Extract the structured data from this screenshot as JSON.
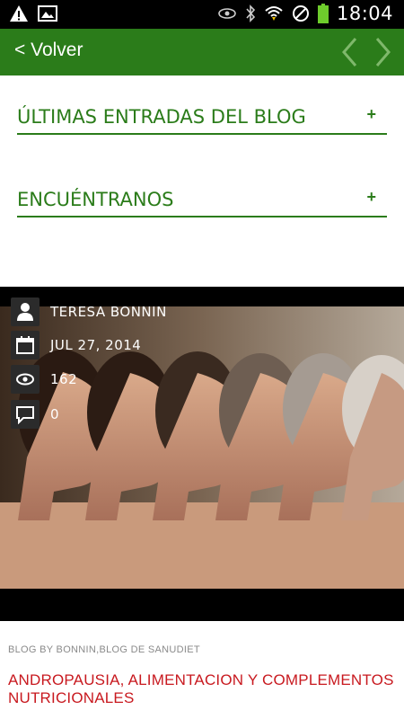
{
  "status_bar": {
    "time": "18:04"
  },
  "header": {
    "back_label": "< Volver"
  },
  "sections": [
    {
      "label": "ÚLTIMAS ENTRADAS DEL BLOG",
      "expand": "+"
    },
    {
      "label": "ENCUÉNTRANOS",
      "expand": "+"
    }
  ],
  "post": {
    "author": "TERESA BONNIN",
    "date": "JUL 27, 2014",
    "views": "162",
    "comments": "0",
    "category": "BLOG BY BONNIN,BLOG DE SANUDIET",
    "title": "ANDROPAUSIA, ALIMENTACION Y COMPLEMENTOS NUTRICIONALES"
  },
  "icons": {
    "author": "person-icon",
    "date": "calendar-icon",
    "views": "eye-icon",
    "comments": "comment-icon"
  },
  "colors": {
    "accent": "#2b7c1a",
    "title_red": "#c8191f"
  }
}
